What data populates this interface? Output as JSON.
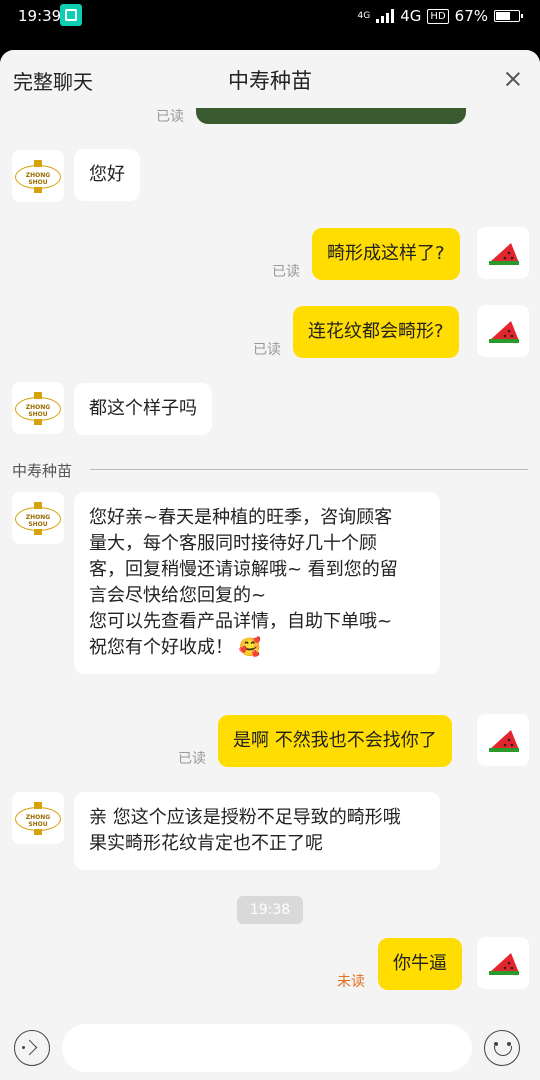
{
  "status_bar": {
    "time": "19:39",
    "network": "4G",
    "signal_badge": "4G",
    "hd_label": "HD",
    "battery_percent": "67%",
    "battery_level": 0.67
  },
  "header": {
    "left_label": "完整聊天",
    "title": "中寿种苗",
    "close_icon": "close-icon"
  },
  "logo_text": "ZHONG SHOU",
  "messages": {
    "img_read": "已读",
    "m1": "您好",
    "m2": "畸形成这样了?",
    "m2_read": "已读",
    "m3": "连花纹都会畸形?",
    "m3_read": "已读",
    "m4": "都这个样子吗",
    "separator_name": "中寿种苗",
    "m5_lines": [
      "您好亲~春天是种植的旺季，咨询顾客",
      "量大，每个客服同时接待好几十个顾",
      "客，回复稍慢还请谅解哦~ 看到您的留",
      "言会尽快给您回复的~",
      "您可以先查看产品详情，自助下单哦~",
      "祝您有个好收成！ 🥰"
    ],
    "m6": "是啊  不然我也不会找你了",
    "m6_read": "已读",
    "m7_lines": [
      "亲 您这个应该是授粉不足导致的畸形哦",
      "果实畸形花纹肯定也不正了呢"
    ],
    "time_divider": "19:38",
    "m8": "你牛逼",
    "m8_status": "未读"
  },
  "input_bar": {
    "voice_icon": "voice-icon",
    "emoji_icon": "emoji-icon"
  },
  "colors": {
    "outgoing_bubble": "#ffdd00",
    "incoming_bubble": "#ffffff",
    "unread": "#e0701f"
  }
}
